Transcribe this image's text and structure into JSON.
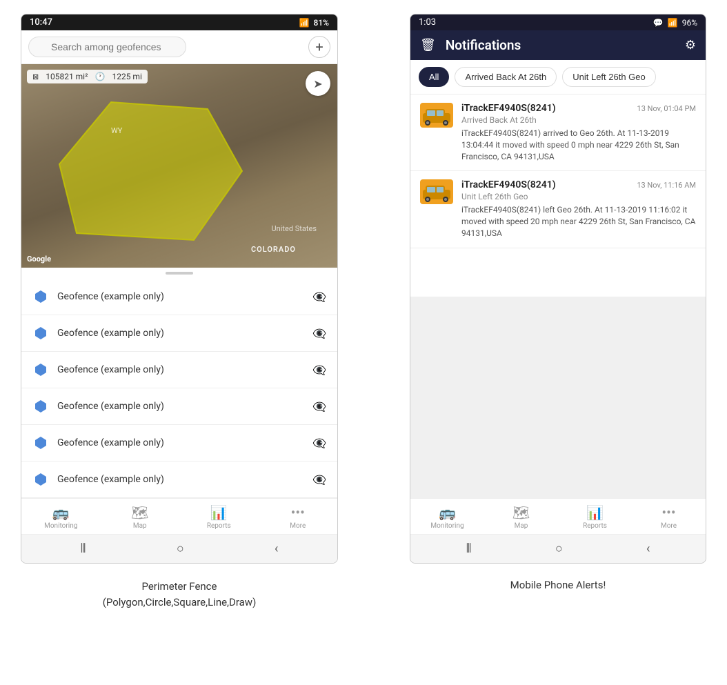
{
  "left_phone": {
    "status_bar": {
      "time": "10:47",
      "signal": "81%"
    },
    "search_placeholder": "Search among geofences",
    "map": {
      "area_label": "105821 mi²",
      "distance_label": "1225 mi",
      "wy_label": "WY",
      "us_label": "United States",
      "colorado_label": "COLORADO"
    },
    "geofence_items": [
      "Geofence (example only)",
      "Geofence (example only)",
      "Geofence (example only)",
      "Geofence (example only)",
      "Geofence (example only)",
      "Geofence (example only)"
    ],
    "bottom_nav": [
      {
        "label": "Monitoring",
        "icon": "🚌"
      },
      {
        "label": "Map",
        "icon": "🗺"
      },
      {
        "label": "Reports",
        "icon": "📊"
      },
      {
        "label": "More",
        "icon": "···"
      }
    ]
  },
  "right_phone": {
    "status_bar": {
      "time": "1:03",
      "signal": "96%"
    },
    "header": {
      "title": "Notifications",
      "trash_icon": "🗑",
      "settings_icon": "⚙"
    },
    "filter_tabs": [
      "All",
      "Arrived Back At 26th",
      "Unit Left 26th Geo"
    ],
    "active_tab": "All",
    "notifications": [
      {
        "device": "iTrackEF4940S(8241)",
        "time": "13 Nov, 01:04 PM",
        "event": "Arrived Back At 26th",
        "body": "iTrackEF4940S(8241) arrived to Geo 26th.    At 11-13-2019 13:04:44 it moved with speed 0 mph near 4229 26th St, San Francisco, CA 94131,USA"
      },
      {
        "device": "iTrackEF4940S(8241)",
        "time": "13 Nov, 11:16 AM",
        "event": "Unit Left 26th Geo",
        "body": "iTrackEF4940S(8241) left Geo 26th.    At 11-13-2019 11:16:02 it moved with speed 20 mph near 4229 26th St, San Francisco, CA 94131,USA"
      }
    ],
    "bottom_nav": [
      {
        "label": "Monitoring",
        "icon": "🚌"
      },
      {
        "label": "Map",
        "icon": "🗺"
      },
      {
        "label": "Reports",
        "icon": "📊"
      },
      {
        "label": "More",
        "icon": "···"
      }
    ]
  },
  "captions": {
    "left": "Perimeter Fence\n(Polygon,Circle,Square,Line,Draw)",
    "right": "Mobile Phone Alerts!"
  }
}
